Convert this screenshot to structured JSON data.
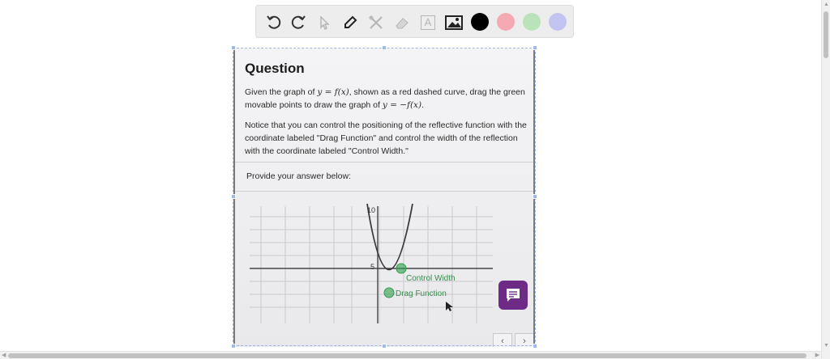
{
  "toolbar": {
    "tools": [
      {
        "name": "undo-icon"
      },
      {
        "name": "redo-icon"
      },
      {
        "name": "cursor-icon"
      },
      {
        "name": "pen-icon"
      },
      {
        "name": "tools-icon"
      },
      {
        "name": "eraser-icon"
      },
      {
        "name": "text-icon",
        "glyph": "A"
      },
      {
        "name": "image-icon"
      }
    ],
    "colors": [
      "#000000",
      "#f4a9b3",
      "#b9e4b9",
      "#c4c4f2"
    ]
  },
  "question": {
    "title": "Question",
    "p1_a": "Given the graph of ",
    "p1_math1": "y = f(x)",
    "p1_b": ", shown as a red dashed curve, drag the green movable points to draw the graph of ",
    "p1_math2": "y = −f(x)",
    "p1_c": ".",
    "p2": "Notice that you can control the positioning of the reflective function with the coordinate labeled \"Drag Function\" and control the width of the reflection with the coordinate labeled \"Control Width.\"",
    "provide": "Provide your answer below:"
  },
  "graph": {
    "ytick_10": "10",
    "ytick_5": "5",
    "label_control": "Control Width",
    "label_drag": "Drag Function",
    "point_color": "#2f9e4c"
  },
  "nav": {
    "prev": "‹",
    "next": "›"
  },
  "colors": {
    "chat_button": "#6d2b86",
    "handle": "#9cbaf0"
  }
}
